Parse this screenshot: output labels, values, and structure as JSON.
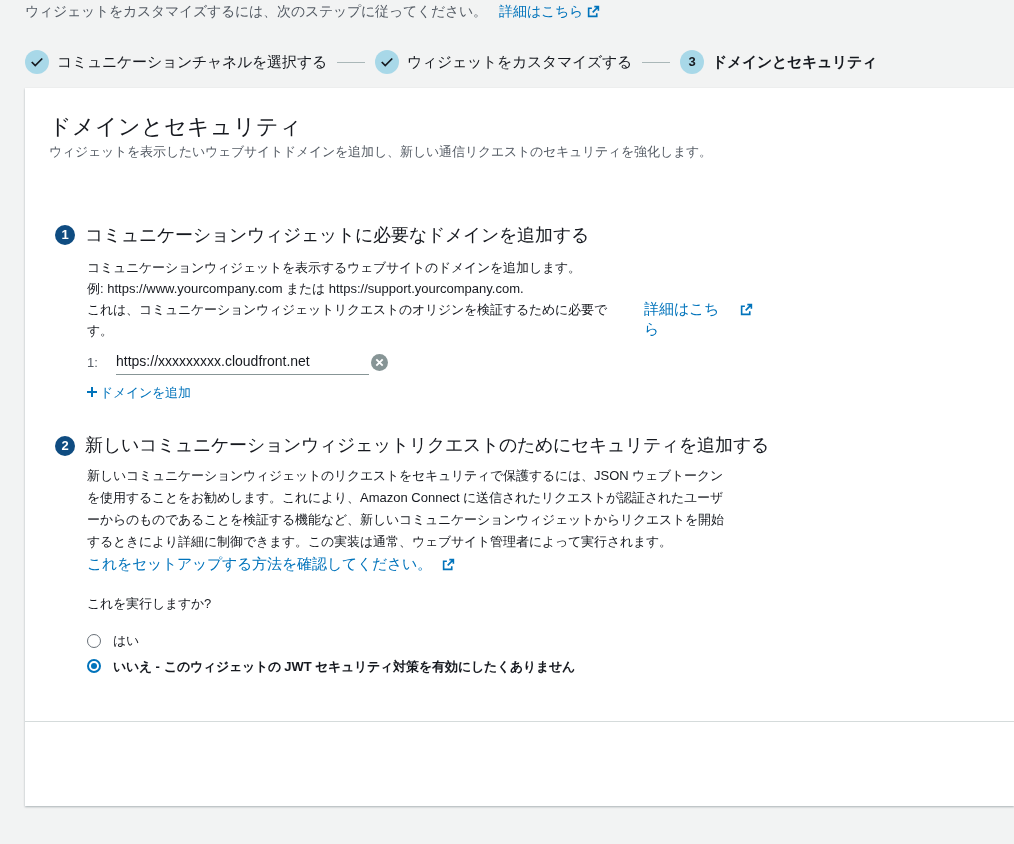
{
  "intro": {
    "text": "ウィジェットをカスタマイズするには、次のステップに従ってください。",
    "link": "詳細はこちら"
  },
  "steps": [
    {
      "label": "コミュニケーションチャネルを選択する",
      "completed": true
    },
    {
      "label": "ウィジェットをカスタマイズする",
      "completed": true
    },
    {
      "label": "ドメインとセキュリティ",
      "completed": false,
      "number": "3"
    }
  ],
  "card": {
    "title": "ドメインとセキュリティ",
    "subtitle": "ウィジェットを表示したいウェブサイトドメインを追加し、新しい通信リクエストのセキュリティを強化します。",
    "sections": [
      {
        "marker": "1",
        "title": "コミュニケーションウィジェットに必要なドメインを追加する",
        "lines": [
          "コミュニケーションウィジェットを表示するウェブサイトのドメインを追加します。",
          "例: https://www.yourcompany.com または https://support.yourcompany.com.",
          "これは、コミュニケーションウィジェットリクエストのオリジンを検証するために必要です。"
        ],
        "link": "詳細はこちら",
        "domains": [
          {
            "index": "1:",
            "value": "https://xxxxxxxxx.cloudfront.net"
          }
        ],
        "add_button": "ドメインを追加"
      },
      {
        "marker": "2",
        "title": "新しいコミュニケーションウィジェットリクエストのためにセキュリティを追加する",
        "paragraph": "新しいコミュニケーションウィジェットのリクエストをセキュリティで保護するには、JSON ウェブトークンを使用することをお勧めします。これにより、Amazon Connect に送信されたリクエストが認証されたユーザーからのものであることを検証する機能など、新しいコミュニケーションウィジェットからリクエストを開始するときにより詳細に制御できます。この実装は通常、ウェブサイト管理者によって実行されます。",
        "link": "これをセットアップする方法を確認してください。",
        "question": "これを実行しますか?",
        "options": [
          {
            "label": "はい",
            "selected": false
          },
          {
            "label": "いいえ - このウィジェットの JWT セキュリティ対策を有効にしたくありません",
            "selected": true
          }
        ]
      }
    ]
  }
}
